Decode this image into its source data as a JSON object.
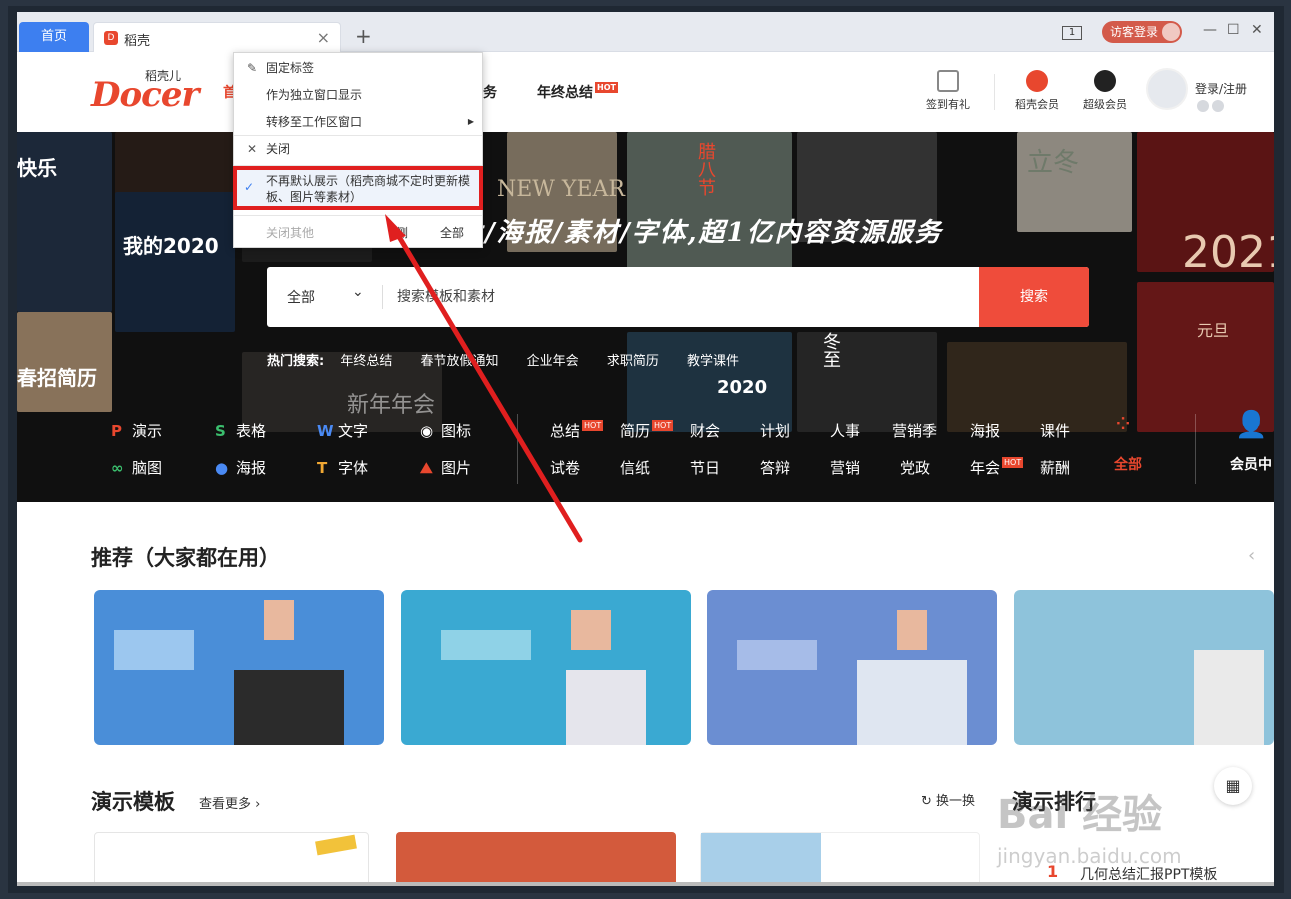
{
  "tabs": {
    "home": "首页",
    "active": "稻壳",
    "new_tab": "+"
  },
  "window": {
    "ratio": "1",
    "guest_login": "访客登录",
    "min": "—",
    "max": "☐",
    "close": "✕"
  },
  "header": {
    "logo_big": "Docer",
    "logo_small": "稻壳儿",
    "nav": [
      "首",
      "务",
      "年终总结"
    ],
    "hot_tag": "HOT",
    "checkin": "签到有礼",
    "docer_member": "稻壳会员",
    "super_member": "超级会员",
    "login": "登录/注册"
  },
  "context_menu": {
    "pin": "固定标签",
    "standalone": "作为独立窗口显示",
    "move_workspace": "转移至工作区窗口",
    "close": "关闭",
    "no_default": "不再默认展示（稻壳商城不定时更新模板、图片等素材）",
    "close_others": "关闭其他",
    "close_right": "侧",
    "close_all": "全部"
  },
  "hero": {
    "slogan": "片/海报/素材/字体,超1亿内容资源服务",
    "search_category": "全部",
    "search_placeholder": "搜索模板和素材",
    "search_button": "搜索",
    "hot_label": "热门搜索:",
    "hot_terms": [
      "年终总结",
      "春节放假通知",
      "企业年会",
      "求职简历",
      "教学课件"
    ],
    "poster_texts": [
      "快乐",
      "我的2020",
      "2021",
      "立冬",
      "腊八节",
      "NEW YEAR",
      "春招简历",
      "2020",
      "新年年会",
      "元旦",
      "冬至"
    ]
  },
  "categories": {
    "row1": [
      "演示",
      "表格",
      "文字",
      "图标",
      "总结",
      "简历",
      "财会",
      "计划",
      "人事",
      "营销季",
      "海报",
      "课件"
    ],
    "row2": [
      "脑图",
      "海报",
      "字体",
      "图片",
      "试卷",
      "信纸",
      "节日",
      "答辩",
      "营销",
      "党政",
      "年会",
      "薪酬"
    ],
    "all": "全部",
    "member": "会员中"
  },
  "sections": {
    "recommend": "推荐（大家都在用）",
    "presentation": "演示模板",
    "see_more": "查看更多",
    "refresh": "换一换",
    "ranking": "演示排行",
    "rank_first": "几何总结汇报PPT模板",
    "rank_num": "1"
  },
  "watermark": {
    "main": "Bai 经验",
    "sub": "jingyan.baidu.com"
  },
  "colors": {
    "brand": "#e8472e",
    "tab_blue": "#3d7ff0",
    "search_btn": "#ef4c3b",
    "highlight": "#e01f1f"
  }
}
